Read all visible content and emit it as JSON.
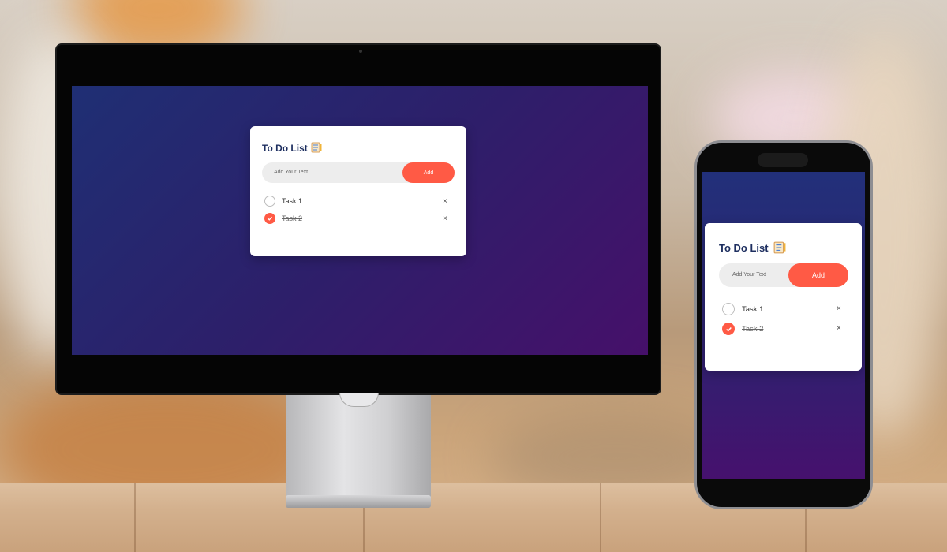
{
  "todo_app": {
    "title": "To Do List",
    "title_icon": "notepad-icon",
    "input_placeholder": "Add Your Text",
    "add_label": "Add",
    "delete_glyph": "×",
    "tasks": [
      {
        "label": "Task 1",
        "completed": false
      },
      {
        "label": "Task 2",
        "completed": true
      }
    ]
  },
  "colors": {
    "accent": "#ff5a45",
    "title_text": "#1e2f60",
    "background_gradient_start": "#1f2f74",
    "background_gradient_end": "#46106a"
  }
}
